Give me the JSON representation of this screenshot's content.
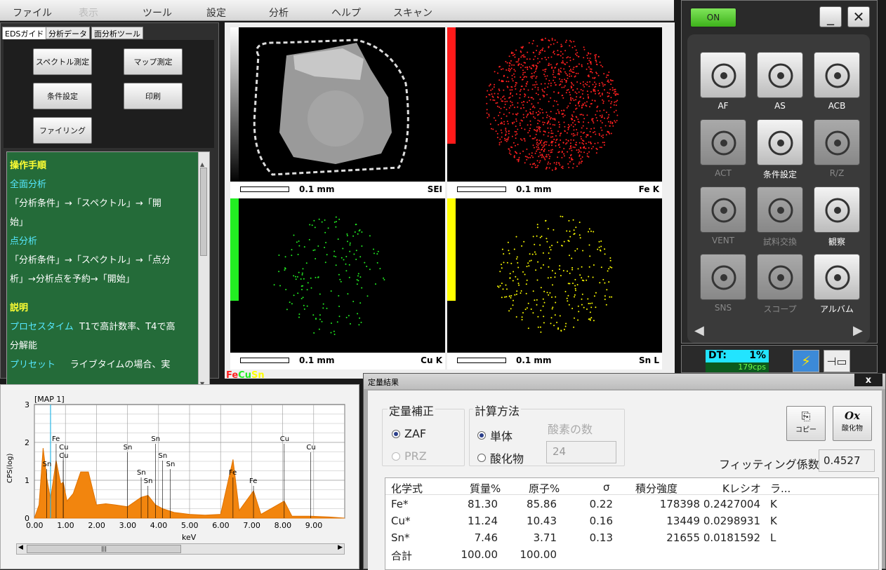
{
  "menubar": {
    "items": [
      "ファイル",
      "表示",
      "ツール",
      "設定",
      "分析",
      "ヘルプ",
      "スキャン"
    ]
  },
  "left_panel": {
    "tabs": [
      "EDSガイド",
      "分析データ",
      "面分析ツール"
    ],
    "buttons": {
      "spectrum": "スペクトル測定",
      "map": "マップ測定",
      "condition": "条件設定",
      "print": "印刷",
      "filing": "ファイリング"
    },
    "guide": {
      "heading1": "操作手順",
      "section1": "全面分析",
      "text1a": "「分析条件」→「スペクトル」→「開",
      "text1b": "始」",
      "section2": "点分析",
      "text2a": "「分析条件」→「スペクトル」→「点分",
      "text2b": "析」→分析点を予約→「開始」",
      "heading2": "説明",
      "term1": "プロセスタイム",
      "desc1a": "T1で高計数率、T4で高",
      "desc1b": "分解能",
      "term2": "プリセット",
      "desc2": "ライブタイムの場合、実"
    }
  },
  "maps": {
    "scale": "0.1 mm",
    "labels": [
      "SEI",
      "Fe K",
      "Cu K",
      "Sn L"
    ],
    "colors": {
      "fe": "#ff2020",
      "cu": "#22ee22",
      "sn": "#ffff00"
    },
    "composite": {
      "fe": "Fe",
      "cu": "Cu",
      "sn": "Sn"
    }
  },
  "right_panel": {
    "on_label": "ON",
    "minimize": "_",
    "close": "✕",
    "icons": [
      {
        "label": "AF",
        "icon": "af-icon",
        "enabled": true
      },
      {
        "label": "AS",
        "icon": "as-icon",
        "enabled": true
      },
      {
        "label": "ACB",
        "icon": "acb-icon",
        "enabled": true
      },
      {
        "label": "ACT",
        "icon": "act-icon",
        "enabled": false
      },
      {
        "label": "条件設定",
        "icon": "condition-icon",
        "enabled": true
      },
      {
        "label": "R/Z",
        "icon": "rz-icon",
        "enabled": false
      },
      {
        "label": "VENT",
        "icon": "vent-icon",
        "enabled": false
      },
      {
        "label": "試料交換",
        "icon": "sample-exchange-icon",
        "enabled": false
      },
      {
        "label": "観察",
        "icon": "observe-icon",
        "enabled": true
      },
      {
        "label": "SNS",
        "icon": "sns-icon",
        "enabled": false
      },
      {
        "label": "スコープ",
        "icon": "scope-icon",
        "enabled": false
      },
      {
        "label": "アルバム",
        "icon": "album-icon",
        "enabled": true
      }
    ]
  },
  "status": {
    "dt_label": "DT:",
    "dt_value": "1%",
    "cps": "179cps"
  },
  "spectrum": {
    "title": "[MAP 1]",
    "ylabel": "CPS(log)",
    "xlabel": "keV",
    "yticks": [
      "0",
      "1",
      "2",
      "3"
    ],
    "xticks": [
      "0.00",
      "1.00",
      "2.00",
      "3.00",
      "4.00",
      "5.00",
      "6.00",
      "7.00",
      "8.00",
      "9.00"
    ],
    "scroll_grip": "|||",
    "peak_labels": [
      {
        "text": "Fe",
        "x": 0.7
      },
      {
        "text": "Cu",
        "x": 0.93
      },
      {
        "text": "Cu",
        "x": 0.93
      },
      {
        "text": "Sn",
        "x": 0.4
      },
      {
        "text": "Sn",
        "x": 3.44
      },
      {
        "text": "Sn",
        "x": 3.66
      },
      {
        "text": "Sn",
        "x": 3.9
      },
      {
        "text": "Sn",
        "x": 3.0
      },
      {
        "text": "Sn",
        "x": 4.13
      },
      {
        "text": "Sn",
        "x": 4.38
      },
      {
        "text": "Fe",
        "x": 6.4
      },
      {
        "text": "Fe",
        "x": 7.06
      },
      {
        "text": "Cu",
        "x": 8.05
      },
      {
        "text": "Cu",
        "x": 8.9
      }
    ]
  },
  "chart_data": {
    "type": "area",
    "title": "[MAP 1]",
    "xlabel": "keV",
    "ylabel": "CPS(log)",
    "xlim": [
      0,
      10
    ],
    "ylim": [
      0,
      3
    ],
    "grid": true,
    "series": [
      {
        "x": [
          0.15,
          0.28,
          0.4,
          0.52,
          0.7,
          0.85,
          0.93,
          1.05,
          1.25,
          1.49,
          1.74,
          2.0,
          2.3,
          2.6,
          3.0,
          3.44,
          3.66,
          3.9,
          4.13,
          4.5,
          5.0,
          5.5,
          6.0,
          6.4,
          6.6,
          7.06,
          7.3,
          8.05,
          8.3,
          8.9,
          9.5
        ],
        "y": [
          0.35,
          1.85,
          1.05,
          0.5,
          1.52,
          0.9,
          0.95,
          0.45,
          0.65,
          1.22,
          1.22,
          0.35,
          0.38,
          0.35,
          0.3,
          0.55,
          0.6,
          0.35,
          0.25,
          0.15,
          0.1,
          0.08,
          0.1,
          1.55,
          0.2,
          0.72,
          0.1,
          0.45,
          0.05,
          0.05,
          0.03
        ]
      }
    ]
  },
  "dialog": {
    "title": "定量結果",
    "close": "x",
    "correction": {
      "title": "定量補正",
      "options": [
        "ZAF",
        "PRZ"
      ]
    },
    "calc": {
      "title": "計算方法",
      "options": [
        "単体",
        "酸化物"
      ]
    },
    "oxygen": {
      "label": "酸素の数",
      "value": "24"
    },
    "copy_label": "コピー",
    "oxide_label": "酸化物",
    "oxide_icon": "Ox",
    "fitting_label": "フィッティング係数",
    "fitting_value": "0.4527",
    "columns": [
      "化学式",
      "質量%",
      "原子%",
      "σ",
      "積分強度",
      "Kレシオ",
      "ラ..."
    ],
    "rows": [
      [
        "Fe*",
        "81.30",
        "85.86",
        "0.22",
        "178398",
        "0.2427004",
        "K"
      ],
      [
        "Cu*",
        "11.24",
        "10.43",
        "0.16",
        "13449",
        "0.0298931",
        "K"
      ],
      [
        "Sn*",
        "7.46",
        "3.71",
        "0.13",
        "21655",
        "0.0181592",
        "L"
      ]
    ],
    "total": [
      "合計",
      "100.00",
      "100.00"
    ]
  }
}
